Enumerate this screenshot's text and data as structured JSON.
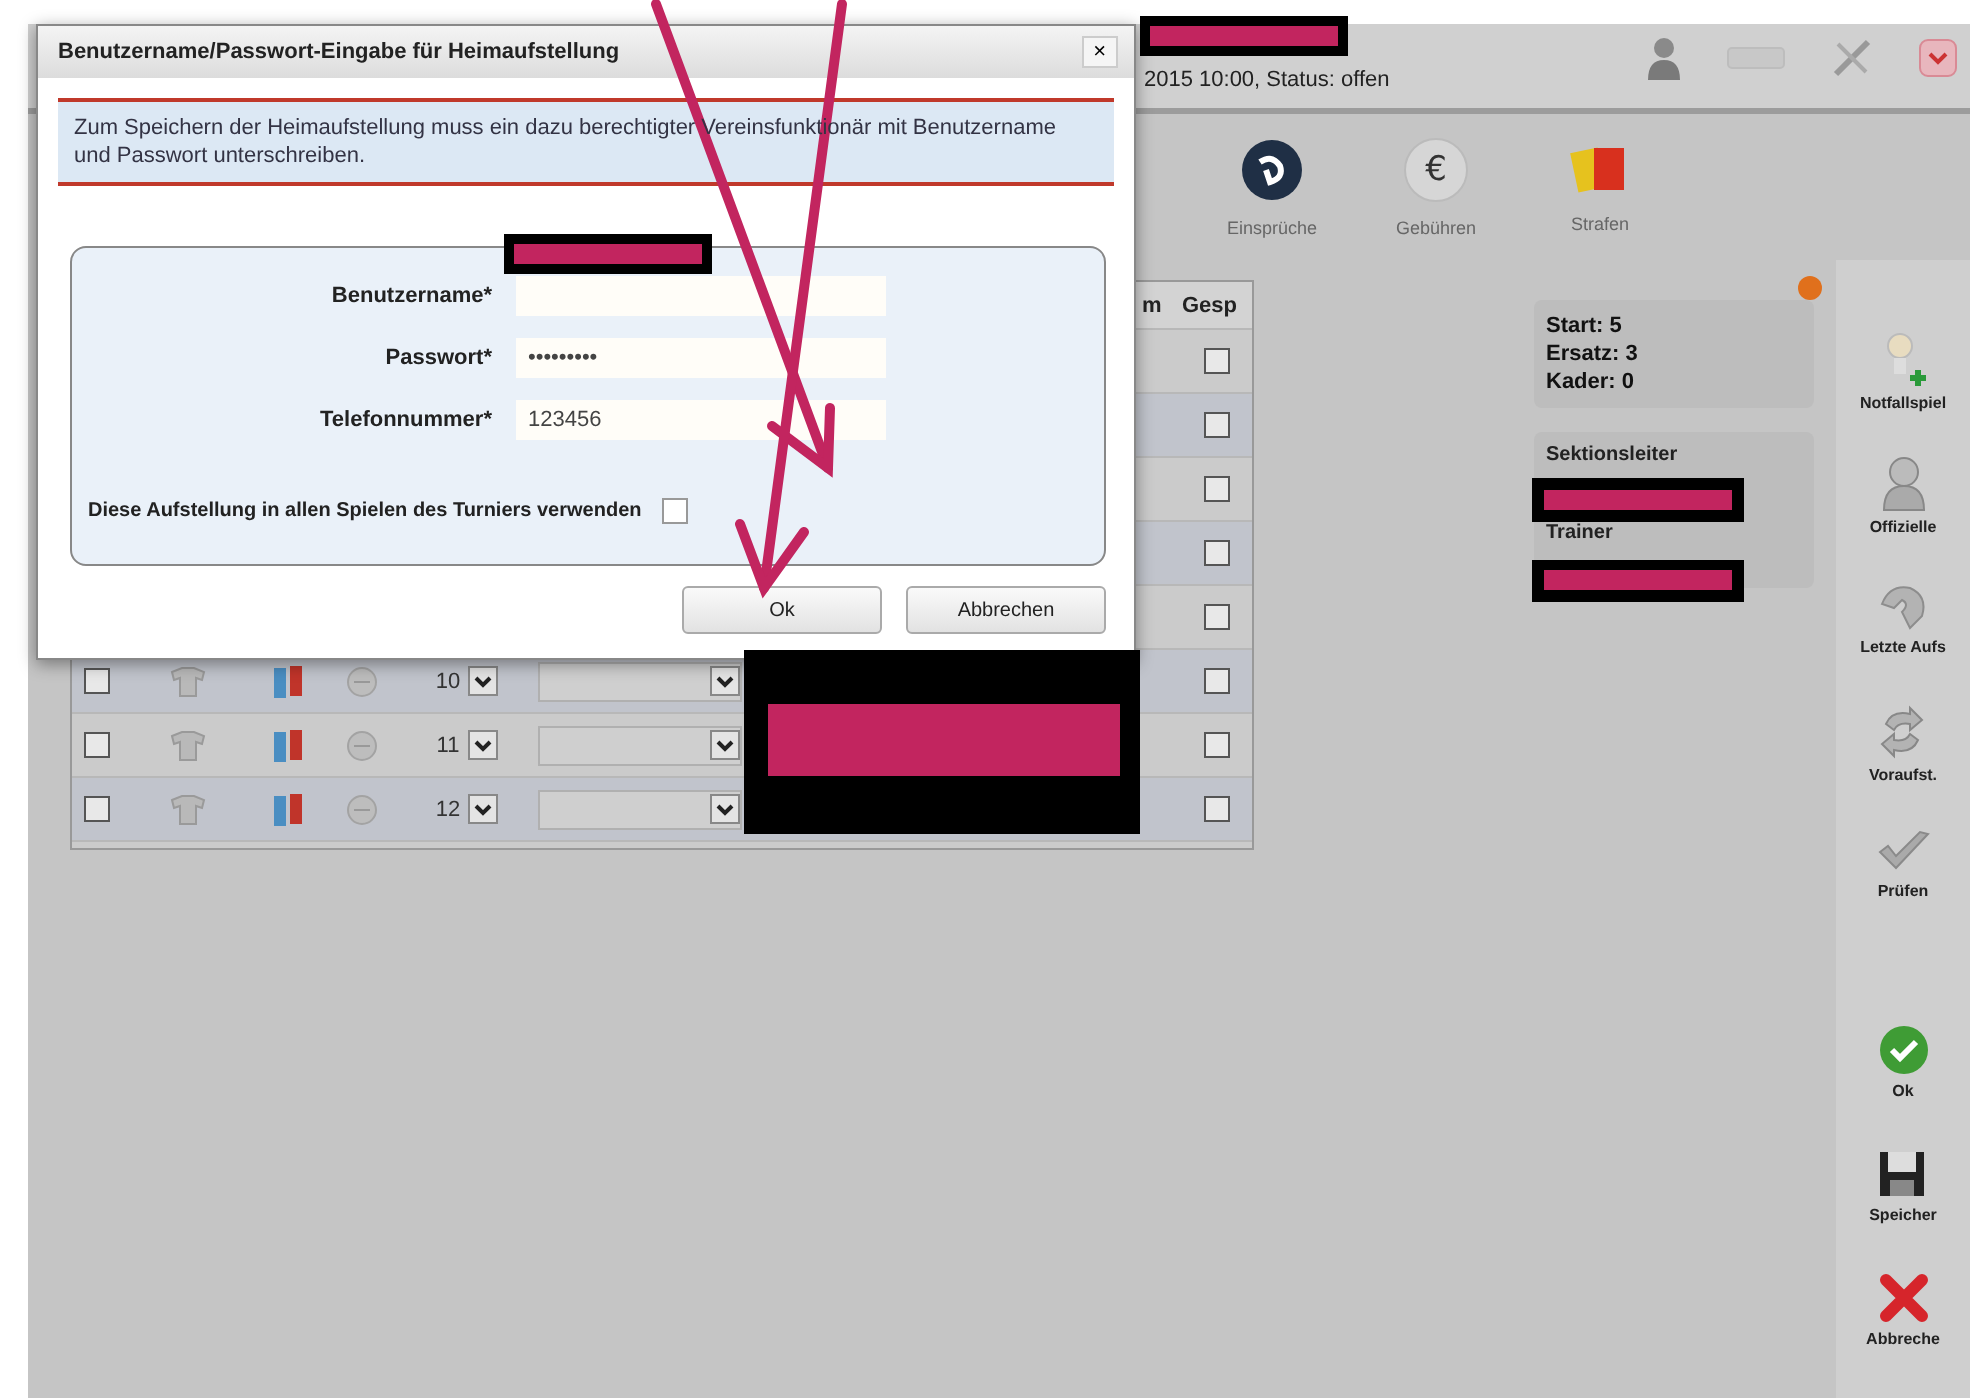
{
  "header": {
    "subtitle": "2015 10:00, Status: offen"
  },
  "toolbar": {
    "items": [
      {
        "label": "Einsprüche"
      },
      {
        "label": "Gebühren",
        "symbol": "€"
      },
      {
        "label": "Strafen"
      }
    ]
  },
  "table": {
    "columns": [
      "m",
      "Gesp"
    ],
    "rows": [
      {
        "kind": "covered",
        "gesp": false
      },
      {
        "kind": "covered",
        "gesp": false
      },
      {
        "kind": "covered",
        "gesp": false
      },
      {
        "kind": "covered",
        "gesp": false
      },
      {
        "kind": "covered",
        "gesp": false
      },
      {
        "kind": "player",
        "checked": false,
        "number": "10",
        "gesp": false
      },
      {
        "kind": "player",
        "checked": false,
        "number": "11",
        "gesp": false
      },
      {
        "kind": "player",
        "checked": false,
        "number": "12",
        "gesp": false
      }
    ]
  },
  "summary": [
    "Start: 5",
    "Ersatz: 3",
    "Kader: 0"
  ],
  "officials": [
    "Sektionsleiter",
    "Trainer"
  ],
  "actions_top": [
    "Notfallspiel",
    "Offizielle",
    "Letzte Aufs",
    "Voraufst.",
    "Prüfen"
  ],
  "actions_bottom": [
    "Ok",
    "Speicher",
    "Abbreche"
  ],
  "dialog": {
    "title": "Benutzername/Passwort-Eingabe für Heimaufstellung",
    "close": "×",
    "info": "Zum Speichern der Heimaufstellung muss ein dazu berechtigter Vereinsfunktionär mit Benutzername und Passwort unterschreiben.",
    "fields": [
      {
        "label": "Benutzername*"
      },
      {
        "label": "Passwort*",
        "value": "•••••••••"
      },
      {
        "label": "Telefonnummer*",
        "value": "123456"
      }
    ],
    "option": {
      "label": "Diese Aufstellung in allen Spielen des Turniers verwenden",
      "checked": false
    },
    "buttons": [
      "Ok",
      "Abbrechen"
    ]
  }
}
